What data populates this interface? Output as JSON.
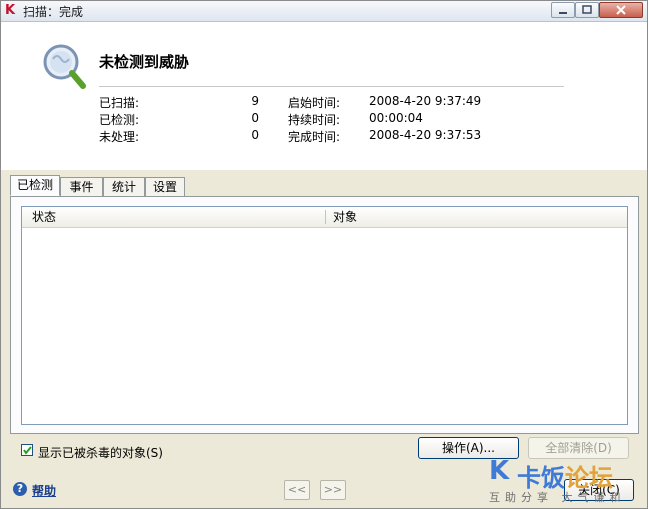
{
  "window": {
    "title": "扫描：完成",
    "app_icon_letter": "K"
  },
  "header": {
    "headline": "未检测到威胁",
    "stats": [
      {
        "label": "已扫描:",
        "value": "9"
      },
      {
        "label": "已检测:",
        "value": "0"
      },
      {
        "label": "未处理:",
        "value": "0"
      }
    ],
    "times": [
      {
        "label": "启始时间:",
        "value": "2008-4-20 9:37:49"
      },
      {
        "label": "持续时间:",
        "value": "00:00:04"
      },
      {
        "label": "完成时间:",
        "value": "2008-4-20 9:37:53"
      }
    ]
  },
  "tabs": [
    {
      "label": "已检测",
      "active": true
    },
    {
      "label": "事件",
      "active": false
    },
    {
      "label": "统计",
      "active": false
    },
    {
      "label": "设置",
      "active": false
    }
  ],
  "list": {
    "columns": [
      "状态",
      "对象"
    ],
    "rows": []
  },
  "checkbox": {
    "label": "显示已被杀毒的对象(S)",
    "checked": true
  },
  "buttons": {
    "action": "操作(A)...",
    "clear_all": "全部清除(D)",
    "close": "关闭(C)",
    "prev": "<<",
    "next": ">>"
  },
  "help": {
    "label": "帮助"
  },
  "watermark": {
    "logo_letter": "K",
    "main": "卡饭",
    "accent": "论坛",
    "sub": "互助分享 大气谦和"
  },
  "colors": {
    "accent": "#3f7ad6",
    "watermark_accent": "#e2a23a",
    "app_icon": "#c8102e"
  }
}
